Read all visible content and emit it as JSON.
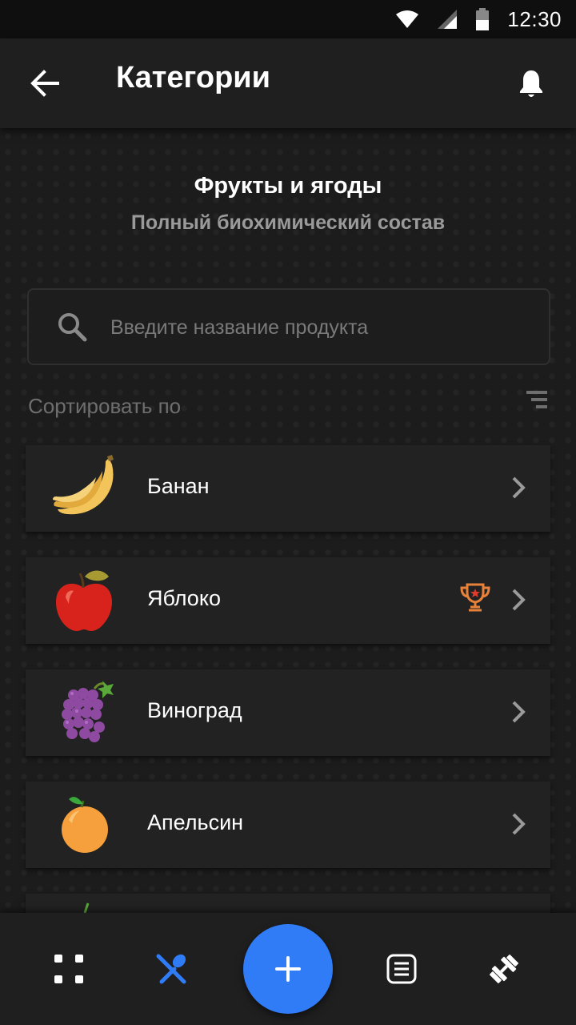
{
  "status_bar": {
    "time": "12:30"
  },
  "app_bar": {
    "title": "Категории"
  },
  "category": {
    "title": "Фрукты и ягоды",
    "subtitle": "Полный биохимический состав"
  },
  "search": {
    "placeholder": "Введите название продукта",
    "value": ""
  },
  "sort": {
    "label": "Сортировать по"
  },
  "items": [
    {
      "name": "Банан",
      "icon": "banana-icon",
      "trophy": false
    },
    {
      "name": "Яблоко",
      "icon": "apple-icon",
      "trophy": true
    },
    {
      "name": "Виноград",
      "icon": "grapes-icon",
      "trophy": false
    },
    {
      "name": "Апельсин",
      "icon": "orange-icon",
      "trophy": false
    }
  ],
  "bottom_nav": {
    "items": [
      "grid-icon",
      "food-icon",
      "add-icon",
      "list-icon",
      "dumbbell-icon"
    ],
    "active": "food-icon"
  },
  "colors": {
    "accent": "#2f7cf6",
    "background": "#1c1c1c",
    "card": "#222222",
    "trophy": "#e8823a"
  }
}
